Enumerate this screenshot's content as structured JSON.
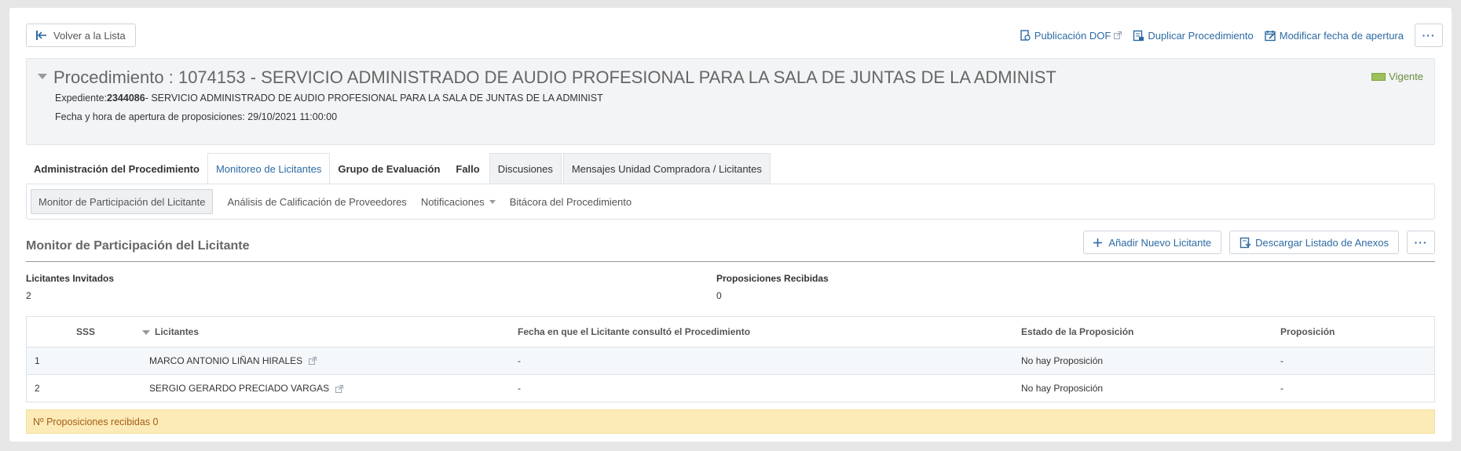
{
  "toolbar": {
    "back_label": "Volver a la Lista",
    "publicacion_label": "Publicación DOF",
    "duplicar_label": "Duplicar Procedimiento",
    "modificar_label": "Modificar fecha de apertura",
    "more_label": "···"
  },
  "procedimiento": {
    "title": "Procedimiento : 1074153 - SERVICIO ADMINISTRADO DE AUDIO PROFESIONAL PARA LA SALA DE JUNTAS DE LA ADMINIST",
    "expediente_label": "Expediente:",
    "expediente_num": "2344086",
    "expediente_desc": "- SERVICIO ADMINISTRADO DE AUDIO PROFESIONAL PARA LA SALA DE JUNTAS DE LA ADMINIST",
    "fecha_line": "Fecha y hora de apertura de proposiciones: 29/10/2021 11:00:00",
    "status": "Vigente",
    "status_color": "#9cc05b"
  },
  "tabs": [
    {
      "label": "Administración del Procedimiento"
    },
    {
      "label": "Monitoreo de Licitantes"
    },
    {
      "label": "Grupo de Evaluación"
    },
    {
      "label": "Fallo"
    },
    {
      "label": "Discusiones"
    },
    {
      "label": "Mensajes Unidad Compradora / Licitantes"
    }
  ],
  "subnav": [
    {
      "label": "Monitor de Participación del Licitante"
    },
    {
      "label": "Análisis de Calificación de Proveedores"
    },
    {
      "label": "Notificaciones"
    },
    {
      "label": "Bitácora del Procedimiento"
    }
  ],
  "section": {
    "title": "Monitor de Participación del Licitante",
    "add_label": "Añadir Nuevo Licitante",
    "download_label": "Descargar Listado de Anexos",
    "more_label": "···"
  },
  "stats": {
    "invitados_label": "Licitantes Invitados",
    "invitados_value": "2",
    "recibidas_label": "Proposiciones Recibidas",
    "recibidas_value": "0"
  },
  "table": {
    "headers": [
      "SSS",
      "Licitantes",
      "Fecha en que el Licitante consultó el Procedimiento",
      "Estado de la Proposición",
      "Proposición"
    ],
    "rows": [
      {
        "num": "1",
        "licitante": "MARCO ANTONIO LIÑAN HIRALES",
        "fecha": "-",
        "estado": "No hay Proposición",
        "proposicion": "-"
      },
      {
        "num": "2",
        "licitante": "SERGIO GERARDO PRECIADO VARGAS",
        "fecha": "-",
        "estado": "No hay Proposición",
        "proposicion": "-"
      }
    ]
  },
  "notice": "Nº Proposiciones recibidas 0",
  "colors": {
    "link": "#2d6aa3",
    "notice_bg": "#fcebb6",
    "notice_text": "#a45c1a"
  }
}
